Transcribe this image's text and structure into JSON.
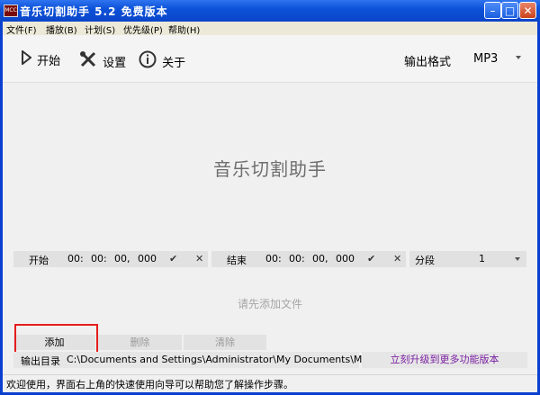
{
  "window": {
    "title": "音乐切割助手 5.2 免费版本",
    "icon_text": "MCC"
  },
  "menu": [
    "文件(F)",
    "播放(B)",
    "计划(S)",
    "优先级(P)",
    "帮助(H)"
  ],
  "toolbar": {
    "start": "开始",
    "settings": "设置",
    "about": "关于",
    "format_label": "输出格式",
    "format_value": "MP3"
  },
  "main": {
    "title": "音乐切割助手",
    "hint": "请先添加文件"
  },
  "start_time": {
    "label": "开始",
    "h": "00:",
    "m": "00:",
    "s": "00,",
    "ms": "000"
  },
  "end_time": {
    "label": "结束",
    "h": "00:",
    "m": "00:",
    "s": "00,",
    "ms": "000"
  },
  "segment": {
    "label": "分段",
    "value": "1"
  },
  "buttons": {
    "add": "添加",
    "delete": "删除",
    "clear": "清除"
  },
  "output": {
    "label": "输出目录",
    "path": "C:\\Documents and Settings\\Administrator\\My Documents\\My Music\\",
    "upgrade": "立刻升级到更多功能版本"
  },
  "status": "欢迎使用，界面右上角的快速使用向导可以帮助您了解操作步骤。"
}
